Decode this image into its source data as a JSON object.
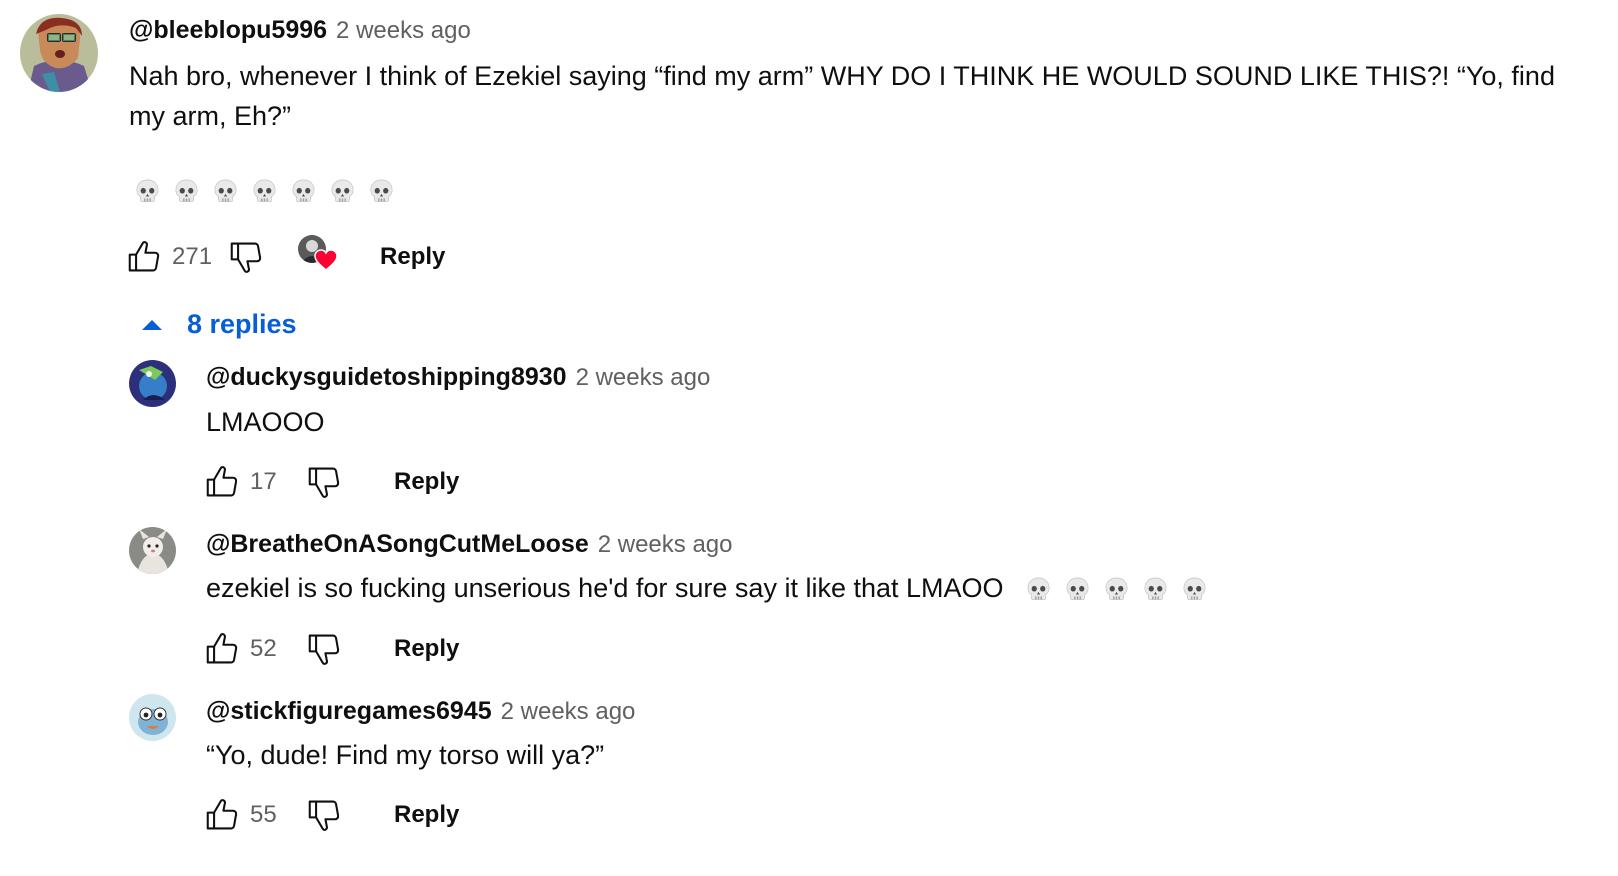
{
  "colors": {
    "link_blue": "#065fd4",
    "meta_gray": "#606060",
    "text": "#0f0f0f",
    "heart": "#ff0033"
  },
  "comment": {
    "author": "@bleeblopu5996",
    "time": "2 weeks ago",
    "text": "Nah bro, whenever I think of Ezekiel saying “find my arm” WHY DO I THINK HE WOULD SOUND LIKE THIS?! “Yo, find my arm, Eh?”",
    "emoji": [
      "skull",
      "skull",
      "skull",
      "skull",
      "skull",
      "skull",
      "skull"
    ],
    "likes": "271",
    "creator_hearted": true,
    "reply_label": "Reply"
  },
  "replies_toggle": {
    "label": "8 replies",
    "icon": "chevron-up-triangle-icon"
  },
  "replies": [
    {
      "author": "@duckysguidetoshipping8930",
      "time": "2 weeks ago",
      "text": "LMAOOO",
      "emoji": [],
      "likes": "17",
      "reply_label": "Reply"
    },
    {
      "author": "@BreatheOnASongCutMeLoose",
      "time": "2 weeks ago",
      "text": "ezekiel is so fucking unserious he'd for sure say it like that LMAOO",
      "emoji": [
        "skull",
        "skull",
        "skull",
        "skull",
        "skull"
      ],
      "likes": "52",
      "reply_label": "Reply"
    },
    {
      "author": "@stickfiguregames6945",
      "time": "2 weeks ago",
      "text": "“Yo, dude! Find my torso will ya?”",
      "emoji": [],
      "likes": "55",
      "reply_label": "Reply"
    }
  ]
}
